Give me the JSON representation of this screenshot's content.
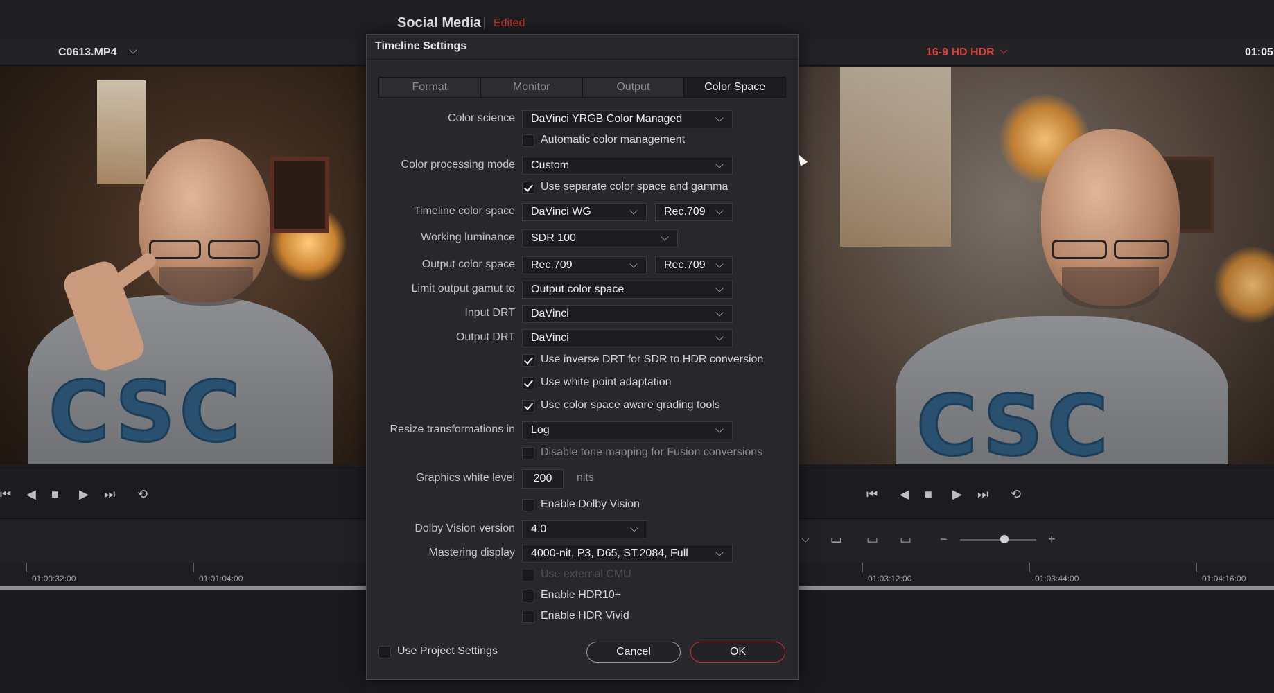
{
  "project": {
    "title": "Social Media",
    "status": "Edited"
  },
  "source_viewer": {
    "clip_name": "C0613.MP4"
  },
  "timeline_viewer": {
    "timeline_name": "16-9 HD HDR",
    "timecode": "01:05"
  },
  "ruler": {
    "left_labels": [
      "01:00:32:00",
      "01:01:04:00"
    ],
    "right_labels": [
      "01:03:12:00",
      "01:03:44:00",
      "01:04:16:00"
    ]
  },
  "dialog": {
    "title": "Timeline Settings",
    "tabs": [
      "Format",
      "Monitor",
      "Output",
      "Color Space"
    ],
    "active_tab": "Color Space",
    "fields": {
      "color_science": {
        "label": "Color science",
        "value": "DaVinci YRGB Color Managed"
      },
      "auto_cm": {
        "label": "Automatic color management",
        "checked": false
      },
      "processing_mode": {
        "label": "Color processing mode",
        "value": "Custom"
      },
      "separate_cs": {
        "label": "Use separate color space and gamma",
        "checked": true
      },
      "timeline_cs": {
        "label": "Timeline color space",
        "value": "DaVinci WG",
        "gamma": "Rec.709"
      },
      "working_lum": {
        "label": "Working luminance",
        "value": "SDR 100"
      },
      "output_cs": {
        "label": "Output color space",
        "value": "Rec.709",
        "gamma": "Rec.709"
      },
      "limit_gamut": {
        "label": "Limit output gamut to",
        "value": "Output color space"
      },
      "input_drt": {
        "label": "Input DRT",
        "value": "DaVinci"
      },
      "output_drt": {
        "label": "Output DRT",
        "value": "DaVinci"
      },
      "inverse_drt": {
        "label": "Use inverse DRT for SDR to HDR conversion",
        "checked": true
      },
      "white_point": {
        "label": "Use white point adaptation",
        "checked": true
      },
      "cs_aware": {
        "label": "Use color space aware grading tools",
        "checked": true
      },
      "resize": {
        "label": "Resize transformations in",
        "value": "Log"
      },
      "disable_tone": {
        "label": "Disable tone mapping for Fusion conversions",
        "checked": false
      },
      "gfx_white": {
        "label": "Graphics white level",
        "value": "200",
        "unit": "nits"
      },
      "dolby": {
        "label": "Enable Dolby Vision",
        "checked": false
      },
      "dolby_version": {
        "label": "Dolby Vision version",
        "value": "4.0"
      },
      "mastering": {
        "label": "Mastering display",
        "value": "4000-nit, P3, D65, ST.2084, Full"
      },
      "external_cmu": {
        "label": "Use external CMU",
        "checked": false
      },
      "hdr10": {
        "label": "Enable HDR10+",
        "checked": false
      },
      "hdr_vivid": {
        "label": "Enable HDR Vivid",
        "checked": false
      }
    },
    "use_project_settings": {
      "label": "Use Project Settings",
      "checked": false
    },
    "cancel_label": "Cancel",
    "ok_label": "OK"
  },
  "colors": {
    "accent_red": "#c5302a",
    "dialog_bg": "#28282c"
  }
}
